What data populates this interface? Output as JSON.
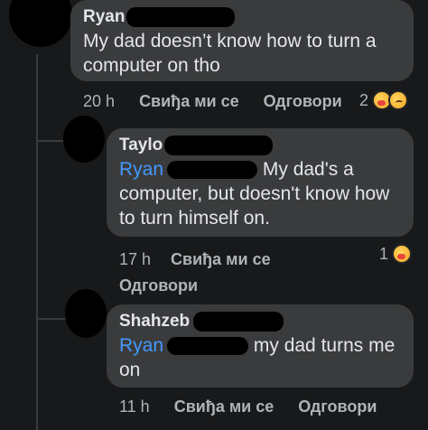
{
  "comments": [
    {
      "author": "Ryan",
      "text": "My dad doesn’t know how to turn a computer on tho",
      "time": "20 h",
      "like_label": "Свиђа ми се",
      "reply_label": "Одговори",
      "reaction_count": "2",
      "reactions": [
        "care-emoji",
        "sad-emoji"
      ]
    },
    {
      "author": "Taylo",
      "mention": "Ryan",
      "text_line1": "My dad's a",
      "text_rest": "computer, but doesn't know how to turn himself on.",
      "time": "17 h",
      "like_label": "Свиђа ми се",
      "reply_label": "Одговори",
      "reaction_count": "1",
      "reactions": [
        "care-emoji"
      ]
    },
    {
      "author": "Shahzeb",
      "mention": "Ryan",
      "text_line1": "my dad turns me",
      "text_rest": "on",
      "time": "11 h",
      "like_label": "Свиђа ми се",
      "reply_label": "Одговори"
    }
  ]
}
